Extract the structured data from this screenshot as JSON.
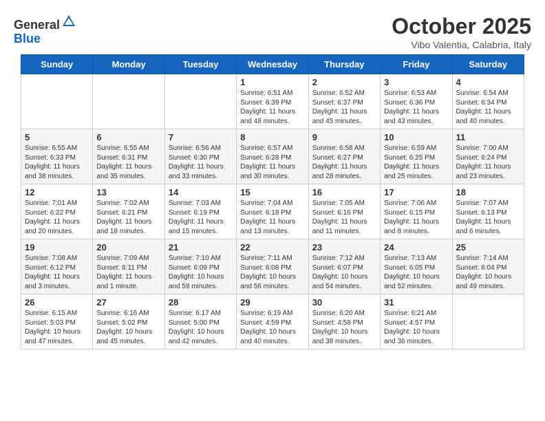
{
  "header": {
    "logo_line1": "General",
    "logo_line2": "Blue",
    "month": "October 2025",
    "location": "Vibo Valentia, Calabria, Italy"
  },
  "weekdays": [
    "Sunday",
    "Monday",
    "Tuesday",
    "Wednesday",
    "Thursday",
    "Friday",
    "Saturday"
  ],
  "weeks": [
    [
      {
        "day": "",
        "info": ""
      },
      {
        "day": "",
        "info": ""
      },
      {
        "day": "",
        "info": ""
      },
      {
        "day": "1",
        "info": "Sunrise: 6:51 AM\nSunset: 6:39 PM\nDaylight: 11 hours\nand 48 minutes."
      },
      {
        "day": "2",
        "info": "Sunrise: 6:52 AM\nSunset: 6:37 PM\nDaylight: 11 hours\nand 45 minutes."
      },
      {
        "day": "3",
        "info": "Sunrise: 6:53 AM\nSunset: 6:36 PM\nDaylight: 11 hours\nand 43 minutes."
      },
      {
        "day": "4",
        "info": "Sunrise: 6:54 AM\nSunset: 6:34 PM\nDaylight: 11 hours\nand 40 minutes."
      }
    ],
    [
      {
        "day": "5",
        "info": "Sunrise: 6:55 AM\nSunset: 6:33 PM\nDaylight: 11 hours\nand 38 minutes."
      },
      {
        "day": "6",
        "info": "Sunrise: 6:55 AM\nSunset: 6:31 PM\nDaylight: 11 hours\nand 35 minutes."
      },
      {
        "day": "7",
        "info": "Sunrise: 6:56 AM\nSunset: 6:30 PM\nDaylight: 11 hours\nand 33 minutes."
      },
      {
        "day": "8",
        "info": "Sunrise: 6:57 AM\nSunset: 6:28 PM\nDaylight: 11 hours\nand 30 minutes."
      },
      {
        "day": "9",
        "info": "Sunrise: 6:58 AM\nSunset: 6:27 PM\nDaylight: 11 hours\nand 28 minutes."
      },
      {
        "day": "10",
        "info": "Sunrise: 6:59 AM\nSunset: 6:25 PM\nDaylight: 11 hours\nand 25 minutes."
      },
      {
        "day": "11",
        "info": "Sunrise: 7:00 AM\nSunset: 6:24 PM\nDaylight: 11 hours\nand 23 minutes."
      }
    ],
    [
      {
        "day": "12",
        "info": "Sunrise: 7:01 AM\nSunset: 6:22 PM\nDaylight: 11 hours\nand 20 minutes."
      },
      {
        "day": "13",
        "info": "Sunrise: 7:02 AM\nSunset: 6:21 PM\nDaylight: 11 hours\nand 18 minutes."
      },
      {
        "day": "14",
        "info": "Sunrise: 7:03 AM\nSunset: 6:19 PM\nDaylight: 11 hours\nand 15 minutes."
      },
      {
        "day": "15",
        "info": "Sunrise: 7:04 AM\nSunset: 6:18 PM\nDaylight: 11 hours\nand 13 minutes."
      },
      {
        "day": "16",
        "info": "Sunrise: 7:05 AM\nSunset: 6:16 PM\nDaylight: 11 hours\nand 11 minutes."
      },
      {
        "day": "17",
        "info": "Sunrise: 7:06 AM\nSunset: 6:15 PM\nDaylight: 11 hours\nand 8 minutes."
      },
      {
        "day": "18",
        "info": "Sunrise: 7:07 AM\nSunset: 6:13 PM\nDaylight: 11 hours\nand 6 minutes."
      }
    ],
    [
      {
        "day": "19",
        "info": "Sunrise: 7:08 AM\nSunset: 6:12 PM\nDaylight: 11 hours\nand 3 minutes."
      },
      {
        "day": "20",
        "info": "Sunrise: 7:09 AM\nSunset: 6:11 PM\nDaylight: 11 hours\nand 1 minute."
      },
      {
        "day": "21",
        "info": "Sunrise: 7:10 AM\nSunset: 6:09 PM\nDaylight: 10 hours\nand 59 minutes."
      },
      {
        "day": "22",
        "info": "Sunrise: 7:11 AM\nSunset: 6:08 PM\nDaylight: 10 hours\nand 56 minutes."
      },
      {
        "day": "23",
        "info": "Sunrise: 7:12 AM\nSunset: 6:07 PM\nDaylight: 10 hours\nand 54 minutes."
      },
      {
        "day": "24",
        "info": "Sunrise: 7:13 AM\nSunset: 6:05 PM\nDaylight: 10 hours\nand 52 minutes."
      },
      {
        "day": "25",
        "info": "Sunrise: 7:14 AM\nSunset: 6:04 PM\nDaylight: 10 hours\nand 49 minutes."
      }
    ],
    [
      {
        "day": "26",
        "info": "Sunrise: 6:15 AM\nSunset: 5:03 PM\nDaylight: 10 hours\nand 47 minutes."
      },
      {
        "day": "27",
        "info": "Sunrise: 6:16 AM\nSunset: 5:02 PM\nDaylight: 10 hours\nand 45 minutes."
      },
      {
        "day": "28",
        "info": "Sunrise: 6:17 AM\nSunset: 5:00 PM\nDaylight: 10 hours\nand 42 minutes."
      },
      {
        "day": "29",
        "info": "Sunrise: 6:19 AM\nSunset: 4:59 PM\nDaylight: 10 hours\nand 40 minutes."
      },
      {
        "day": "30",
        "info": "Sunrise: 6:20 AM\nSunset: 4:58 PM\nDaylight: 10 hours\nand 38 minutes."
      },
      {
        "day": "31",
        "info": "Sunrise: 6:21 AM\nSunset: 4:57 PM\nDaylight: 10 hours\nand 36 minutes."
      },
      {
        "day": "",
        "info": ""
      }
    ]
  ]
}
